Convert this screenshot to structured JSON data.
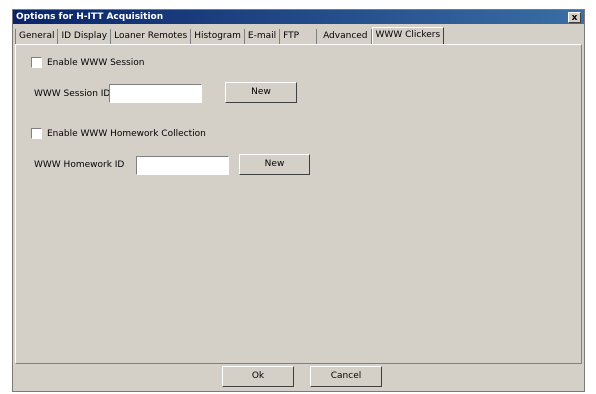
{
  "window": {
    "title": "Options for H-ITT Acquisition",
    "close_glyph": "x"
  },
  "tabs": [
    {
      "label": "General"
    },
    {
      "label": "ID Display"
    },
    {
      "label": "Loaner Remotes"
    },
    {
      "label": "Histogram"
    },
    {
      "label": "E-mail"
    },
    {
      "label": "FTP"
    },
    {
      "label": "Advanced"
    },
    {
      "label": "WWW Clickers",
      "active": true
    }
  ],
  "www_session": {
    "enable_label": "Enable WWW Session",
    "enabled": false,
    "id_label": "WWW Session ID",
    "id_value": "",
    "new_label": "New"
  },
  "www_homework": {
    "enable_label": "Enable WWW Homework Collection",
    "enabled": false,
    "id_label": "WWW Homework ID",
    "id_value": "",
    "new_label": "New"
  },
  "footer": {
    "ok_label": "Ok",
    "cancel_label": "Cancel"
  }
}
